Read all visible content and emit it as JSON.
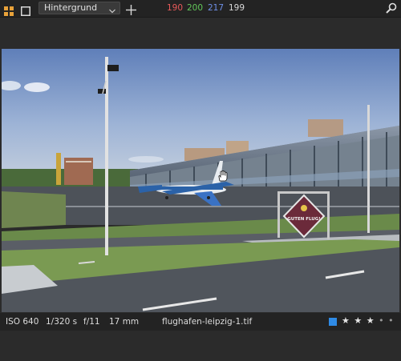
{
  "toolbar": {
    "grid_icon": "grid-icon",
    "frame_icon": "frame-icon",
    "layer_select": {
      "value": "Hintergrund"
    },
    "color_picker_icon": "crosshair-icon",
    "readout": {
      "r": "190",
      "g": "200",
      "b": "217",
      "l": "199"
    },
    "colors": {
      "r": "#e85a5a",
      "g": "#62c85a",
      "b": "#6e8fe6"
    },
    "zoom_icon": "magnifier-icon"
  },
  "viewer": {
    "image_description": "photo of airport terminal with airplane",
    "sign_text": "GUTEN FLUG!"
  },
  "statusbar": {
    "iso": "ISO 640",
    "shutter": "1/320 s",
    "aperture": "f/11",
    "focal_length": "17 mm",
    "filename": "flughafen-leipzig-1.tif",
    "color_label": "#2f8be6",
    "rating": 3,
    "rating_max": 5
  }
}
